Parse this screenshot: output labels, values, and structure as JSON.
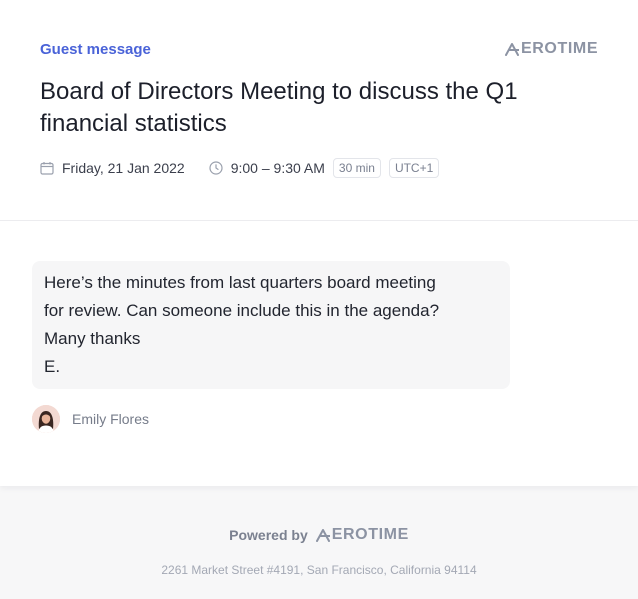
{
  "header": {
    "eyebrow": "Guest message",
    "logo_text": "EROTIME",
    "title": "Board of Directors Meeting to discuss the Q1 financial statistics"
  },
  "meta": {
    "date": "Friday, 21 Jan 2022",
    "time": "9:00 – 9:30 AM",
    "duration": "30 min",
    "timezone": "UTC+1",
    "icons": {
      "date": "calendar-icon",
      "time": "clock-icon"
    }
  },
  "message": {
    "lines": [
      "Here’s the minutes from last quarters board meeting",
      "for review. Can someone include this in the agenda?",
      "Many thanks",
      "E."
    ],
    "author": "Emily Flores"
  },
  "footer": {
    "powered_by": "Powered by",
    "logo_text": "EROTIME",
    "address": "2261 Market Street #4191, San Francisco, California 94114"
  },
  "colors": {
    "accent": "#4a63d8",
    "logo": "#8c93a3",
    "bubble_bg": "#f6f6f7",
    "footer_bg": "#f7f7f8"
  }
}
